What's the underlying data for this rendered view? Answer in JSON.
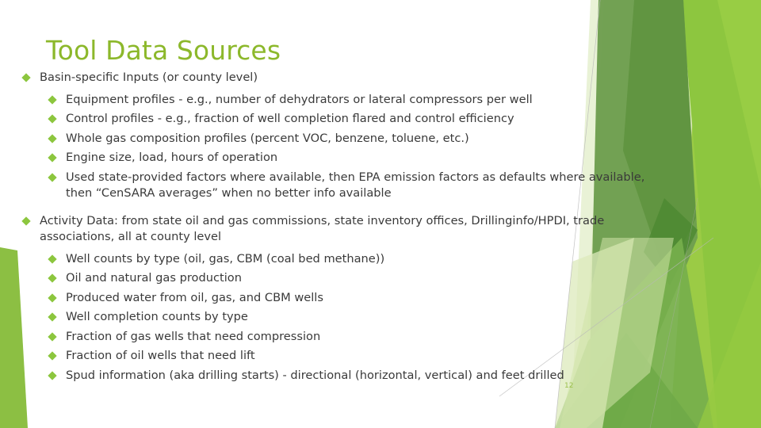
{
  "slide": {
    "title": "Tool Data Sources",
    "slide_number": "12",
    "title_color": "#8CB82B",
    "bullet_color": "#8CC63E",
    "text_color": "#3A3A3A",
    "background_color": "#FFFFFF",
    "accent_colors": {
      "bright_green": "#8DC63F",
      "mid_green": "#6E9E4F",
      "dark_green": "#5C8C3E",
      "pale_green": "#D9E8B8",
      "very_pale_green": "#E9F2D6",
      "left_triangle_green": "#8CBF43"
    }
  },
  "content": {
    "sections": [
      {
        "heading": "Basin-specific Inputs (or county level)",
        "items": [
          "Equipment profiles  - e.g., number of dehydrators or lateral compressors per well",
          "Control profiles  - e.g., fraction of well completion flared and control efficiency",
          "Whole gas composition profiles (percent VOC, benzene, toluene, etc.)",
          "Engine size, load, hours of operation",
          "Used state-provided factors where available, then EPA emission factors as defaults where available, then “CenSARA averages” when no better info available"
        ]
      },
      {
        "heading": "Activity Data: from state oil and gas commissions, state inventory offices, Drillinginfo/HPDI, trade associations, all at county level",
        "items": [
          "Well counts by type (oil, gas, CBM (coal bed methane))",
          "Oil and natural gas production",
          "Produced water from oil, gas, and CBM wells",
          "Well completion counts by type",
          "Fraction of gas wells that need compression",
          "Fraction of oil wells that need lift",
          "Spud information (aka drilling starts) - directional (horizontal, vertical) and feet drilled"
        ]
      }
    ]
  }
}
